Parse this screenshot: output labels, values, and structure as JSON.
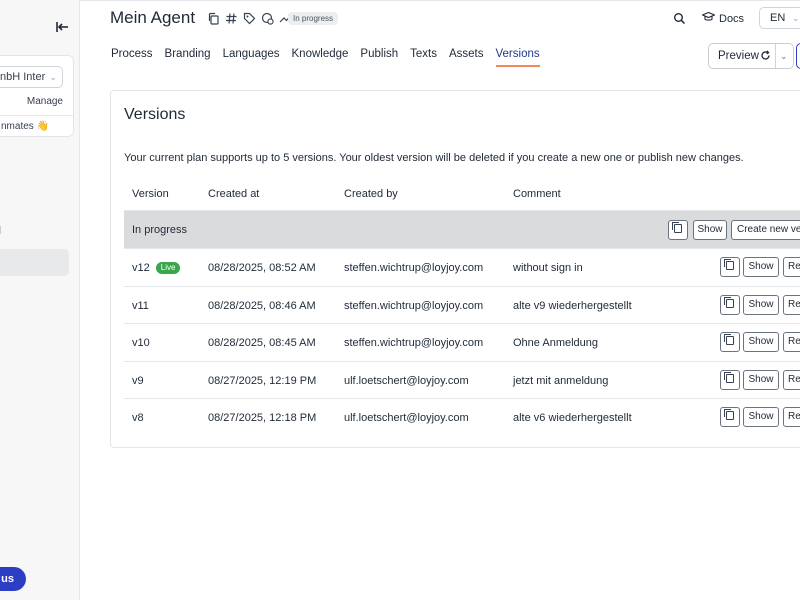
{
  "sidebar": {
    "org_name": "nbH Inter",
    "manage_label": "Manage",
    "teammates_label": "nmates 👋",
    "upgrade_label": "us"
  },
  "header": {
    "title": "Mein Agent",
    "status": "In progress",
    "docs_label": "Docs",
    "language": "EN",
    "preview_label": "Preview"
  },
  "tabs": [
    {
      "label": "Process"
    },
    {
      "label": "Branding"
    },
    {
      "label": "Languages"
    },
    {
      "label": "Knowledge"
    },
    {
      "label": "Publish"
    },
    {
      "label": "Texts"
    },
    {
      "label": "Assets"
    },
    {
      "label": "Versions",
      "active": true
    }
  ],
  "versions": {
    "title": "Versions",
    "description": "Your current plan supports up to 5 versions. Your oldest version will be deleted if you create a new one or publish new changes.",
    "columns": [
      "Version",
      "Created at",
      "Created by",
      "Comment"
    ],
    "in_progress": {
      "label": "In progress",
      "show_label": "Show",
      "create_label": "Create new ve"
    },
    "show_label": "Show",
    "restore_label": "Re",
    "live_label": "Live",
    "rows": [
      {
        "version": "v12",
        "created_at": "08/28/2025, 08:52 AM",
        "created_by": "steffen.wichtrup@loyjoy.com",
        "comment": "without sign in"
      },
      {
        "version": "v11",
        "created_at": "08/28/2025, 08:46 AM",
        "created_by": "steffen.wichtrup@loyjoy.com",
        "comment": "alte v9 wiederhergestellt"
      },
      {
        "version": "v10",
        "created_at": "08/28/2025, 08:45 AM",
        "created_by": "steffen.wichtrup@loyjoy.com",
        "comment": "Ohne Anmeldung"
      },
      {
        "version": "v9",
        "created_at": "08/27/2025, 12:19 PM",
        "created_by": "ulf.loetschert@loyjoy.com",
        "comment": "jetzt mit anmeldung"
      },
      {
        "version": "v8",
        "created_at": "08/27/2025, 12:18 PM",
        "created_by": "ulf.loetschert@loyjoy.com",
        "comment": "alte v6 wiederhergestellt"
      }
    ]
  },
  "colors": {
    "accent": "#1e3a8a",
    "tab_underline": "#f08a5d",
    "live": "#3aa64c",
    "upgrade": "#2c3fc4"
  }
}
